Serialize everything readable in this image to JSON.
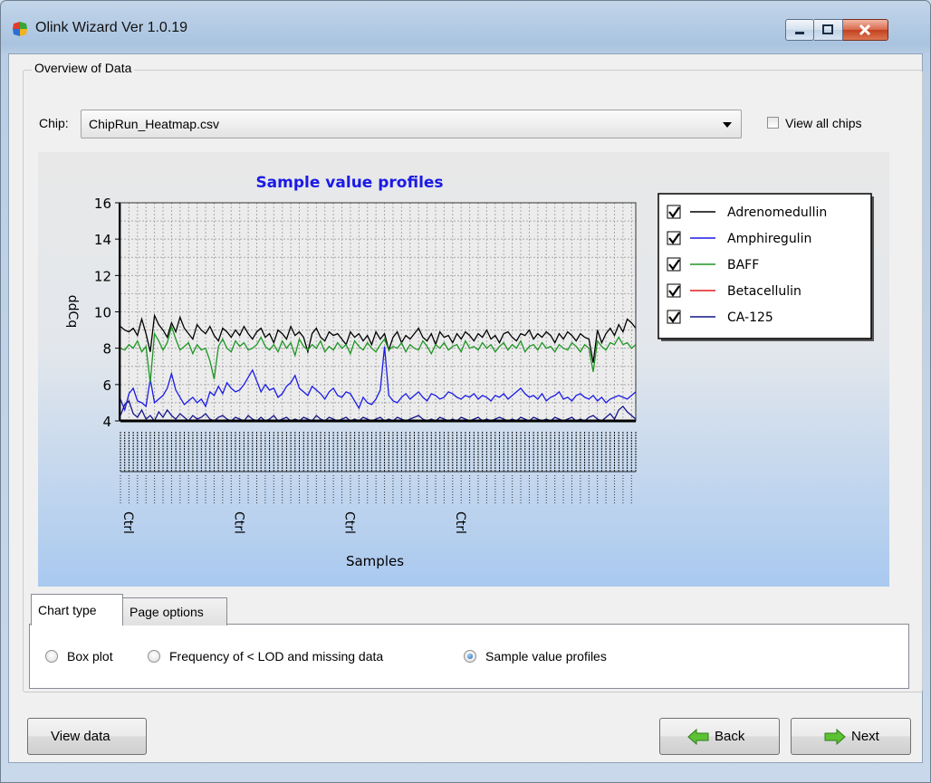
{
  "window": {
    "title": "Olink Wizard Ver 1.0.19"
  },
  "overview": {
    "group_title": "Overview of Data",
    "chip_label": "Chip:",
    "chip_value": "ChipRun_Heatmap.csv",
    "view_all_chips_label": "View all chips",
    "view_all_chips_checked": false
  },
  "chart_tabs": {
    "tab_chart_type": "Chart type",
    "tab_page_options": "Page options",
    "options": [
      "Box plot",
      "Frequency of < LOD and missing data",
      "Sample value profiles"
    ],
    "selected": "Sample value profiles"
  },
  "footer": {
    "view_data": "View data",
    "back": "Back",
    "next": "Next"
  },
  "colors": {
    "title_blue": "#1a1ae6",
    "accent_green": "#3aa534"
  },
  "chart_data": {
    "type": "line",
    "title": "Sample value profiles",
    "xlabel": "Samples",
    "ylabel": "ddCq",
    "ylim": [
      4,
      16
    ],
    "yticks": [
      4,
      6,
      8,
      10,
      12,
      14,
      16
    ],
    "grid": true,
    "legend_position": "right",
    "x_tick_labels": [
      "Ctrl",
      "Ctrl",
      "Ctrl",
      "Ctrl"
    ],
    "series": [
      {
        "name": "Adrenomedullin",
        "color": "#000000",
        "checked": true,
        "values": [
          9.2,
          9.0,
          8.9,
          9.1,
          8.7,
          9.6,
          8.8,
          7.8,
          9.8,
          9.3,
          9.0,
          8.6,
          9.4,
          8.9,
          9.7,
          9.1,
          8.8,
          8.5,
          9.3,
          9.0,
          8.8,
          9.2,
          8.7,
          8.4,
          9.1,
          8.9,
          8.6,
          9.0,
          8.7,
          9.2,
          8.8,
          8.5,
          8.9,
          9.1,
          8.6,
          8.8,
          8.3,
          9.0,
          8.8,
          8.5,
          9.2,
          8.7,
          8.9,
          8.6,
          7.8,
          8.8,
          9.1,
          8.6,
          8.4,
          8.9,
          8.7,
          8.8,
          8.5,
          8.2,
          8.9,
          8.6,
          8.8,
          8.4,
          8.7,
          8.2,
          8.9,
          8.5,
          8.8,
          7.9,
          8.6,
          8.9,
          8.3,
          8.7,
          8.5,
          8.8,
          9.1,
          8.6,
          8.4,
          8.8,
          8.2,
          8.9,
          8.6,
          8.7,
          8.3,
          8.8,
          8.5,
          8.9,
          8.7,
          8.4,
          8.8,
          8.6,
          9.0,
          8.5,
          8.7,
          8.3,
          8.8,
          8.9,
          8.6,
          8.4,
          8.8,
          8.7,
          9.0,
          8.5,
          8.8,
          8.6,
          8.9,
          8.7,
          8.3,
          8.8,
          8.5,
          8.9,
          8.7,
          8.4,
          8.8,
          8.6,
          8.5,
          7.2,
          9.0,
          8.3,
          8.8,
          9.1,
          8.7,
          9.3,
          8.9,
          9.6,
          9.4,
          9.1
        ]
      },
      {
        "name": "Amphiregulin",
        "color": "#1a1ae6",
        "checked": true,
        "values": [
          5.2,
          4.6,
          5.5,
          5.8,
          5.1,
          5.0,
          4.8,
          6.3,
          5.0,
          5.2,
          5.4,
          5.8,
          6.6,
          5.7,
          5.3,
          4.9,
          5.1,
          5.3,
          5.0,
          5.2,
          4.8,
          5.6,
          5.4,
          5.9,
          5.5,
          6.1,
          5.8,
          5.6,
          5.7,
          6.0,
          6.4,
          6.8,
          6.2,
          5.6,
          6.0,
          5.7,
          5.8,
          5.3,
          5.5,
          5.9,
          6.1,
          6.5,
          5.8,
          5.6,
          5.4,
          5.9,
          5.7,
          5.5,
          5.2,
          5.6,
          5.8,
          5.4,
          5.3,
          5.6,
          5.5,
          5.1,
          4.7,
          5.3,
          5.0,
          4.9,
          5.2,
          5.7,
          8.1,
          5.4,
          5.1,
          5.0,
          5.3,
          5.5,
          5.2,
          5.4,
          5.6,
          5.3,
          5.1,
          5.5,
          5.4,
          5.2,
          5.3,
          5.6,
          5.5,
          5.3,
          5.2,
          5.4,
          5.3,
          5.5,
          5.2,
          5.4,
          5.3,
          5.1,
          5.4,
          5.3,
          5.5,
          5.2,
          5.4,
          5.6,
          5.8,
          5.5,
          5.3,
          5.4,
          5.2,
          5.5,
          5.1,
          5.3,
          5.4,
          5.6,
          5.2,
          5.3,
          5.1,
          5.4,
          5.5,
          5.3,
          5.2,
          5.4,
          5.1,
          5.3,
          5.0,
          5.2,
          5.3,
          5.4,
          5.3,
          5.2,
          5.4,
          5.6
        ]
      },
      {
        "name": "BAFF",
        "color": "#1e9624",
        "checked": true,
        "values": [
          8.0,
          7.9,
          8.2,
          8.0,
          8.4,
          7.8,
          8.1,
          6.1,
          8.8,
          8.4,
          7.9,
          8.3,
          9.2,
          8.5,
          7.9,
          8.1,
          8.3,
          7.7,
          8.2,
          7.9,
          8.0,
          7.3,
          6.3,
          8.1,
          8.5,
          8.0,
          7.8,
          8.4,
          8.1,
          8.3,
          7.9,
          8.0,
          8.2,
          8.6,
          8.1,
          7.9,
          8.2,
          7.8,
          8.4,
          8.0,
          8.3,
          7.6,
          8.5,
          8.1,
          7.9,
          8.2,
          8.0,
          8.4,
          7.8,
          8.1,
          7.9,
          8.3,
          8.0,
          8.2,
          7.7,
          8.4,
          8.1,
          7.9,
          8.3,
          8.0,
          7.8,
          8.2,
          8.5,
          7.9,
          8.1,
          8.0,
          8.3,
          7.8,
          8.2,
          8.0,
          7.9,
          8.4,
          8.1,
          7.7,
          8.2,
          8.0,
          8.3,
          7.9,
          8.1,
          8.2,
          7.8,
          8.4,
          8.0,
          8.1,
          7.9,
          8.3,
          8.0,
          8.2,
          7.8,
          8.1,
          8.3,
          7.9,
          8.2,
          8.0,
          8.4,
          7.8,
          8.1,
          8.2,
          7.9,
          8.3,
          8.0,
          8.1,
          7.8,
          8.2,
          8.0,
          7.9,
          8.3,
          8.1,
          7.8,
          8.2,
          8.0,
          6.7,
          8.4,
          8.1,
          7.9,
          8.3,
          8.2,
          8.6,
          8.2,
          8.3,
          8.0,
          8.2
        ]
      },
      {
        "name": "Betacellulin",
        "color": "#e01b1b",
        "checked": true,
        "values": [
          4.0,
          4.0,
          4.0,
          4.0,
          4.0,
          4.0,
          4.0,
          4.0,
          4.0,
          4.0,
          4.0,
          4.0,
          4.0,
          4.0,
          4.0,
          4.0,
          4.0,
          4.0,
          4.0,
          4.0,
          4.0,
          4.0,
          4.0,
          4.0,
          4.0,
          4.0,
          4.0,
          4.0,
          4.0,
          4.0,
          4.0,
          4.0,
          4.0,
          4.0,
          4.0,
          4.0,
          4.0,
          4.0,
          4.0,
          4.0,
          4.0,
          4.0,
          4.0,
          4.0,
          4.0,
          4.0,
          4.0,
          4.0,
          4.0,
          4.0,
          4.0,
          4.0,
          4.0,
          4.0,
          4.0,
          4.0,
          4.0,
          4.0,
          4.0,
          4.0,
          4.0,
          4.0,
          4.0,
          4.0,
          4.0,
          4.0,
          4.0,
          4.0,
          4.0,
          4.0,
          4.0,
          4.0,
          4.0,
          4.0,
          4.0,
          4.0,
          4.0,
          4.0,
          4.0,
          4.0,
          4.0,
          4.0,
          4.0,
          4.0,
          4.0,
          4.0,
          4.0,
          4.0,
          4.0,
          4.0,
          4.0,
          4.0,
          4.0,
          4.0,
          4.0,
          4.0,
          4.0,
          4.0,
          4.0,
          4.0,
          4.0,
          4.0,
          4.0,
          4.0,
          4.0,
          4.0,
          4.0,
          4.0,
          4.0,
          4.0,
          4.0,
          4.0,
          4.0,
          4.0,
          4.0,
          4.0,
          4.0,
          4.0,
          4.0,
          4.0,
          4.0,
          4.0
        ]
      },
      {
        "name": "CA-125",
        "color": "#14148c",
        "checked": true,
        "values": [
          4.3,
          4.9,
          5.1,
          4.4,
          4.2,
          4.6,
          4.1,
          4.3,
          4.0,
          4.5,
          4.2,
          4.6,
          4.3,
          4.1,
          4.4,
          4.2,
          4.0,
          4.3,
          4.1,
          4.2,
          4.4,
          4.1,
          4.0,
          4.2,
          4.3,
          4.1,
          4.0,
          4.2,
          4.1,
          4.0,
          4.3,
          4.1,
          4.0,
          4.2,
          4.0,
          4.1,
          4.3,
          4.0,
          4.1,
          4.2,
          4.0,
          4.1,
          4.0,
          4.2,
          4.1,
          4.0,
          4.3,
          4.1,
          4.0,
          4.2,
          4.1,
          4.0,
          4.1,
          4.2,
          4.0,
          4.1,
          4.0,
          4.2,
          4.1,
          4.0,
          4.1,
          4.2,
          4.0,
          4.1,
          4.0,
          4.2,
          4.1,
          4.0,
          4.1,
          4.2,
          4.3,
          4.1,
          4.0,
          4.1,
          4.0,
          4.2,
          4.1,
          4.0,
          4.1,
          4.0,
          4.2,
          4.1,
          4.0,
          4.1,
          4.2,
          4.0,
          4.1,
          4.0,
          4.1,
          4.2,
          4.1,
          4.0,
          4.1,
          4.0,
          4.2,
          4.1,
          4.0,
          4.2,
          4.1,
          4.0,
          4.1,
          4.0,
          4.2,
          4.1,
          4.0,
          4.1,
          4.2,
          4.0,
          4.1,
          4.0,
          4.2,
          4.3,
          4.1,
          4.0,
          4.2,
          4.4,
          4.1,
          4.6,
          4.8,
          4.5,
          4.3,
          4.1
        ]
      }
    ]
  }
}
